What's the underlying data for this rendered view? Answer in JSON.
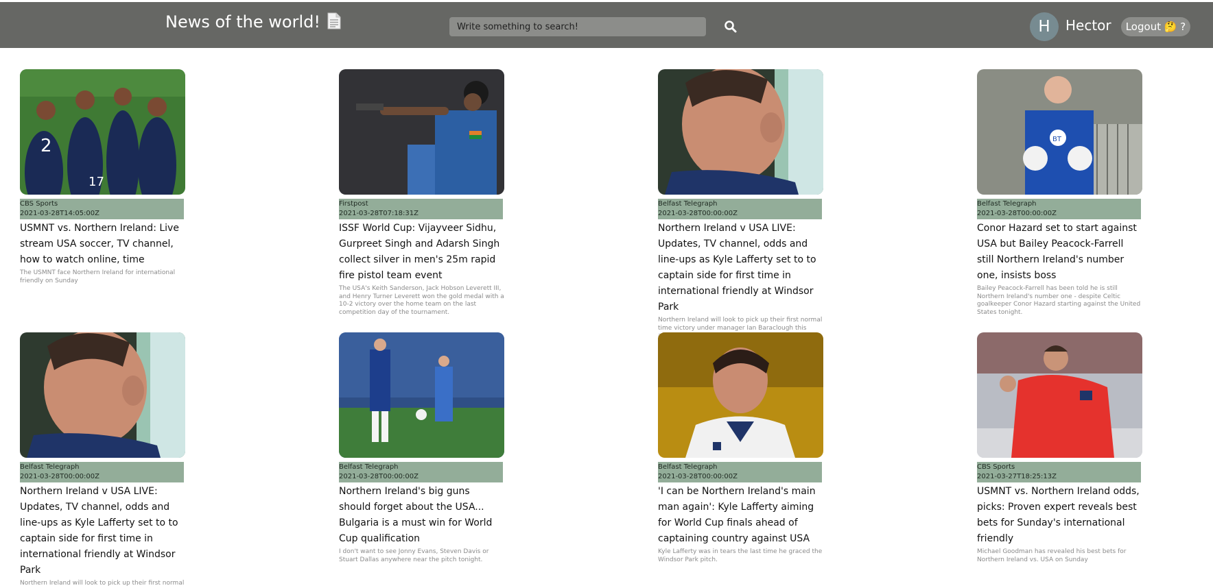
{
  "header": {
    "title": "News of the world!",
    "title_icon": "page-facing-up-icon",
    "search_placeholder": "Write something to search!",
    "search_icon": "search-icon",
    "user": {
      "avatar_letter": "H",
      "name": "Hector"
    },
    "logout_label": "Logout 🤔 ?"
  },
  "colors": {
    "header_bg": "#666764",
    "input_bg": "#8c8d8a",
    "meta_bg": "#93ad99",
    "avatar_bg": "#778b91"
  },
  "articles": [
    {
      "source": "CBS Sports",
      "date": "2021-03-28T14:05:00Z",
      "title": "USMNT vs. Northern Ireland: Live stream USA soccer, TV channel, how to watch online, time",
      "description": "The USMNT face Northern Ireland for international friendly on Sunday",
      "image": "usa-team-celebrating-photo"
    },
    {
      "source": "Firstpost",
      "date": "2021-03-28T07:18:31Z",
      "title": "ISSF World Cup: Vijayveer Sidhu, Gurpreet Singh and Adarsh Singh collect silver in men's 25m rapid fire pistol team event",
      "description": "The USA's Keith Sanderson, Jack Hobson Leverett III, and Henry Turner Leverett won the gold medal with a 10-2 victory over the home team on the last competition day of the tournament.",
      "image": "pistol-shooter-photo"
    },
    {
      "source": "Belfast Telegraph",
      "date": "2021-03-28T00:00:00Z",
      "title": "Northern Ireland v USA LIVE: Updates, TV channel, odds and line-ups as Kyle Lafferty set to to captain side for first time in international friendly at Windsor Park",
      "description": "Northern Ireland will look to pick up their first normal time victory under manager Ian Baraclough this afternoon when the USA visit Belfast for an international friendly.",
      "image": "player-profile-photo"
    },
    {
      "source": "Belfast Telegraph",
      "date": "2021-03-28T00:00:00Z",
      "title": "Conor Hazard set to start against USA but Bailey Peacock-Farrell still Northern Ireland's number one, insists boss",
      "description": "Bailey Peacock-Farrell has been told he is still Northern Ireland's number one - despite Celtic goalkeeper Conor Hazard starting against the United States tonight.",
      "image": "goalkeeper-photo"
    },
    {
      "source": "Belfast Telegraph",
      "date": "2021-03-28T00:00:00Z",
      "title": "Northern Ireland v USA LIVE: Updates, TV channel, odds and line-ups as Kyle Lafferty set to to captain side for first time in international friendly at Windsor Park",
      "description": "Northern Ireland will look to pick up their first normal",
      "image": "player-profile-photo"
    },
    {
      "source": "Belfast Telegraph",
      "date": "2021-03-28T00:00:00Z",
      "title": "Northern Ireland's big guns should forget about the USA... Bulgaria is a must win for World Cup qualification",
      "description": "I don't want to see Jonny Evans, Steven Davis or Stuart Dallas anywhere near the pitch tonight.",
      "image": "training-pitch-photo"
    },
    {
      "source": "Belfast Telegraph",
      "date": "2021-03-28T00:00:00Z",
      "title": "'I can be Northern Ireland's main man again': Kyle Lafferty aiming for World Cup finals ahead of captaining country against USA",
      "description": "Kyle Lafferty was in tears the last time he graced the Windsor Park pitch.",
      "image": "player-portrait-photo"
    },
    {
      "source": "CBS Sports",
      "date": "2021-03-27T18:25:13Z",
      "title": "USMNT vs. Northern Ireland odds, picks: Proven expert reveals best bets for Sunday's international friendly",
      "description": "Michael Goodman has revealed his best bets for Northern Ireland vs. USA on Sunday",
      "image": "player-celebrating-photo"
    }
  ]
}
